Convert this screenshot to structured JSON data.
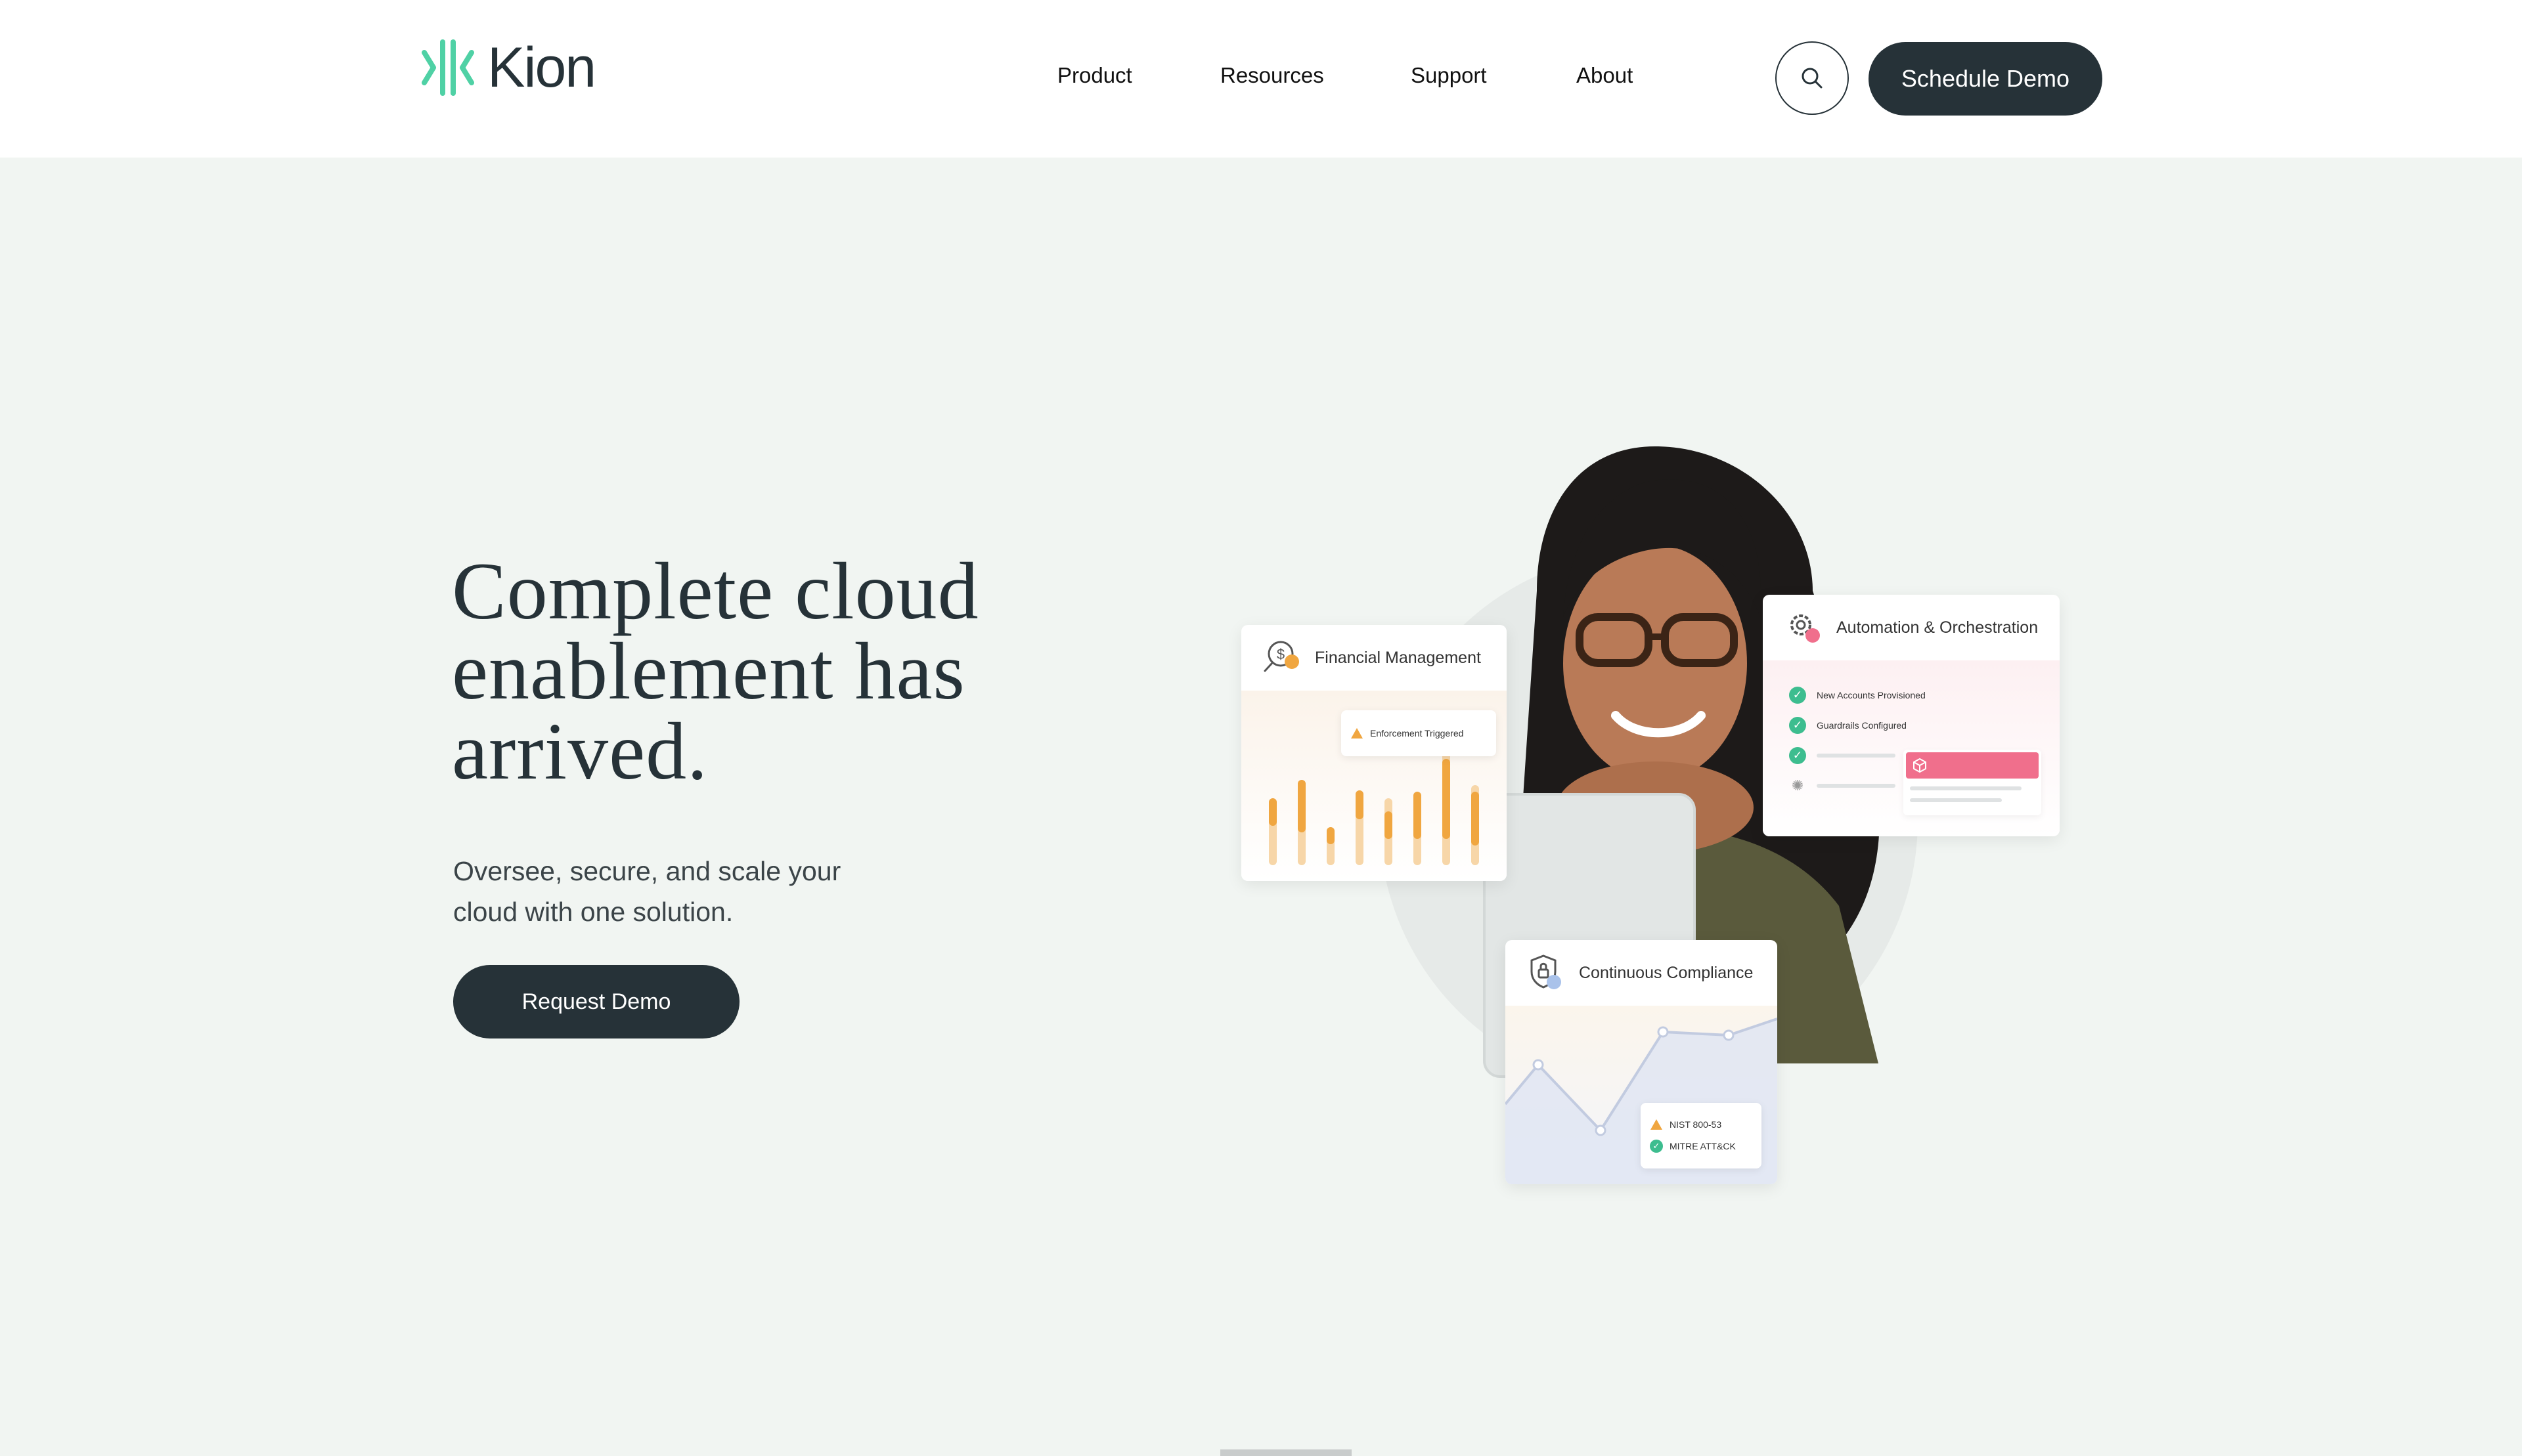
{
  "header": {
    "logo_text": "Kion",
    "nav": [
      "Product",
      "Resources",
      "Support",
      "About"
    ],
    "search_icon": "search-icon",
    "cta": "Schedule Demo"
  },
  "hero": {
    "title_lines": [
      "Complete cloud",
      "enablement has",
      "arrived."
    ],
    "subtitle_lines": [
      "Oversee, secure, and scale your",
      "cloud with one solution."
    ],
    "cta": "Request Demo"
  },
  "illustration": {
    "financial": {
      "title": "Financial Management",
      "alert": "Enforcement Triggered",
      "icon": "dollar-search-icon"
    },
    "automation": {
      "title": "Automation & Orchestration",
      "items": [
        "New Accounts Provisioned",
        "Guardrails Configured"
      ],
      "icon": "gear-icon"
    },
    "compliance": {
      "title": "Continuous Compliance",
      "badges": [
        "NIST 800-53",
        "MITRE ATT&CK"
      ],
      "icon": "shield-lock-icon"
    }
  },
  "colors": {
    "brand_dark": "#263238",
    "logo_teal": "#4fd1a5",
    "bar_orange": "#f0a640",
    "alert_pink": "#f06f8c",
    "check_green": "#3dbd8f",
    "background": "#f1f5f2"
  }
}
